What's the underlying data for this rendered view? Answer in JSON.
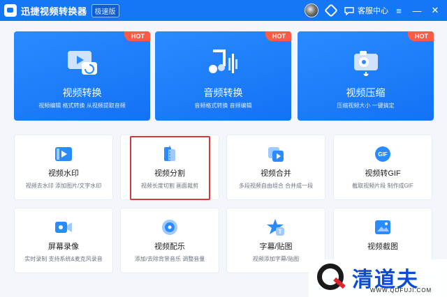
{
  "titlebar": {
    "app_title": "迅捷视频转换器",
    "edition": "极速版",
    "service": "客服中心",
    "minimize": "—",
    "close": "✕",
    "menu": "≡"
  },
  "big_cards": [
    {
      "title": "视频转换",
      "desc": "视频编辑 格式转换 从视频提取音频",
      "badge": "HOT",
      "icon": "video-convert-icon"
    },
    {
      "title": "音频转换",
      "desc": "音频格式转换 音频编辑",
      "badge": "HOT",
      "icon": "music-note-icon"
    },
    {
      "title": "视频压缩",
      "desc": "压缩视频大小 一键搞定",
      "badge": "HOT",
      "icon": "camera-compress-icon"
    }
  ],
  "small_cards": [
    {
      "title": "视频水印",
      "desc": "视频去水印 添加图片/文字水印",
      "icon": "watermark-icon"
    },
    {
      "title": "视频分割",
      "desc": "视频长度切割 画面裁剪",
      "icon": "split-icon"
    },
    {
      "title": "视频合并",
      "desc": "多段视频自由组合 合并成一段",
      "icon": "merge-icon"
    },
    {
      "title": "视频转GIF",
      "desc": "截取视频片段 制作成GIF",
      "icon": "gif-icon"
    },
    {
      "title": "屏幕录像",
      "desc": "实时录制 支持系统&麦克风录音",
      "icon": "screen-record-icon"
    },
    {
      "title": "视频配乐",
      "desc": "添加/去除背景音乐 调整音量",
      "icon": "music-dub-icon"
    },
    {
      "title": "字幕/贴图",
      "desc": "视频添加字幕/贴图",
      "icon": "subtitle-star-icon"
    },
    {
      "title": "视频截图",
      "desc": "",
      "icon": "screenshot-icon"
    }
  ],
  "watermark": {
    "text": "清道夫",
    "url": "WWW.QDFUJI.COM"
  },
  "colors": {
    "primary": "#1677f6",
    "hot": "#ff5a45",
    "highlight": "#d9363e"
  }
}
